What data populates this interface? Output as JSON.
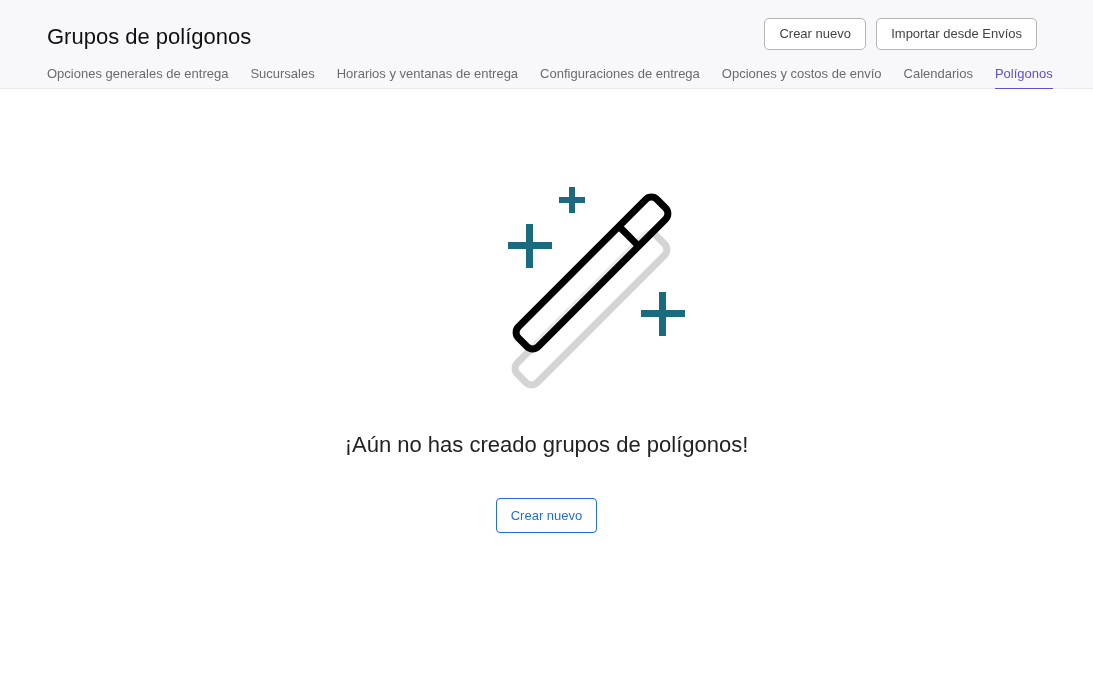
{
  "header": {
    "title": "Grupos de polígonos",
    "buttons": [
      "Crear nuevo",
      "Importar desde Envíos"
    ]
  },
  "tabs": [
    {
      "label": "Opciones generales de entrega",
      "selected": false
    },
    {
      "label": "Sucursales",
      "selected": false
    },
    {
      "label": "Horarios y ventanas de entrega",
      "selected": false
    },
    {
      "label": "Configuraciones de entrega",
      "selected": false
    },
    {
      "label": "Opciones y costos de envío",
      "selected": false
    },
    {
      "label": "Calendarios",
      "selected": false
    },
    {
      "label": "Polígonos",
      "selected": true
    }
  ],
  "empty_state": {
    "message": "¡Aún no has creado grupos de polígonos!",
    "button": "Crear nuevo"
  }
}
